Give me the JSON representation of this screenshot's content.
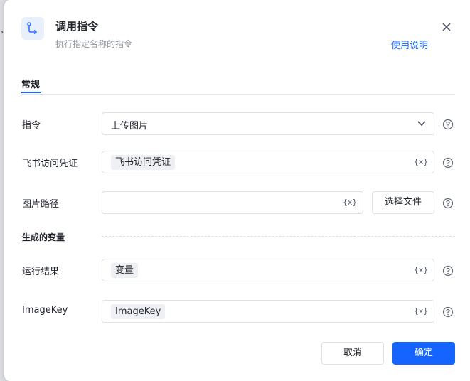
{
  "dialog": {
    "title": "调用指令",
    "subtitle": "执行指定名称的指令",
    "help_link": "使用说明"
  },
  "tabs": [
    {
      "label": "常规",
      "active": true
    }
  ],
  "form": {
    "instruction": {
      "label": "指令",
      "value": "上传图片"
    },
    "credential": {
      "label": "飞书访问凭证",
      "value": "飞书访问凭证"
    },
    "image_path": {
      "label": "图片路径",
      "value": "",
      "button": "选择文件"
    }
  },
  "generated_vars": {
    "section_label": "生成的变量",
    "run_result": {
      "label": "运行结果",
      "value": "变量"
    },
    "image_key": {
      "label": "ImageKey",
      "value": "ImageKey"
    }
  },
  "icons": {
    "variable": "{x}",
    "header": "flow-arrow-icon",
    "help": "question-circle-icon",
    "close": "close-icon"
  },
  "footer": {
    "cancel": "取消",
    "confirm": "确定"
  },
  "colors": {
    "accent": "#1664ff",
    "border": "#dee0e3",
    "chip_bg": "#eef0f3"
  }
}
